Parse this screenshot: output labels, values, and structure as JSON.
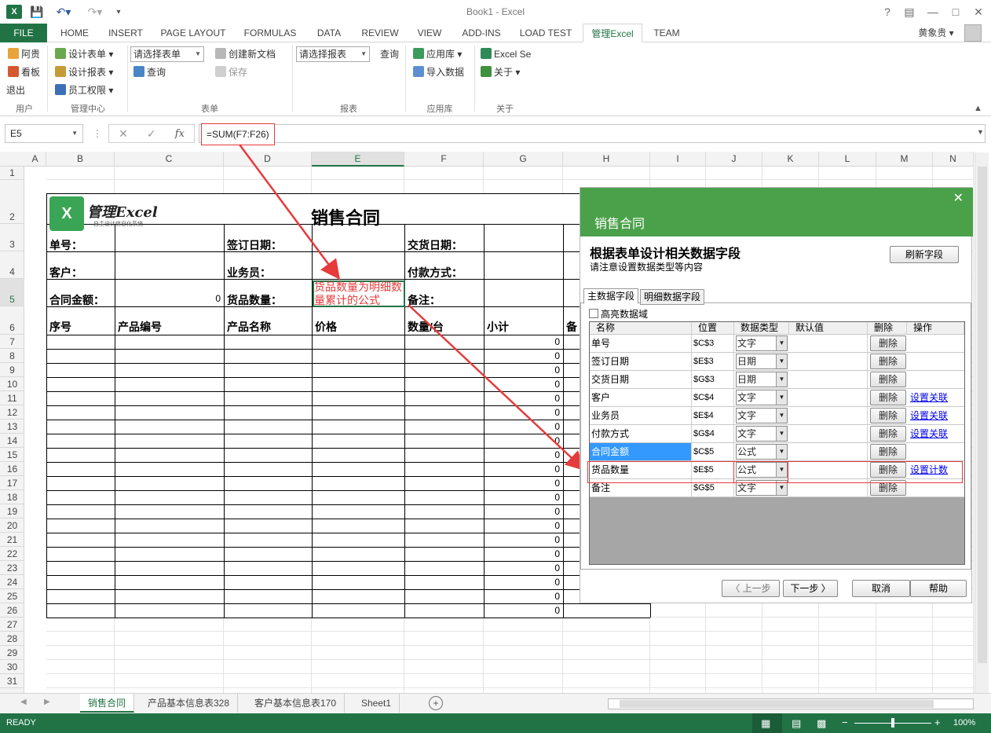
{
  "window": {
    "title": "Book1 - Excel",
    "user": "黄象贵"
  },
  "ribbon_tabs": [
    "FILE",
    "HOME",
    "INSERT",
    "PAGE LAYOUT",
    "FORMULAS",
    "DATA",
    "REVIEW",
    "VIEW",
    "ADD-INS",
    "LOAD TEST",
    "管理Excel",
    "TEAM"
  ],
  "ribbon": {
    "user_group": {
      "label": "用户",
      "items": [
        "阿贵",
        "看板",
        "退出"
      ]
    },
    "admin_group": {
      "label": "管理中心",
      "items": [
        "设计表单",
        "设计报表",
        "员工权限"
      ]
    },
    "form_group": {
      "label": "表单",
      "select_form": "请选择表单",
      "query": "查询",
      "new_doc": "创建新文档",
      "save": "保存"
    },
    "report_group": {
      "label": "报表",
      "select_report": "请选择报表",
      "query": "查询"
    },
    "app_group": {
      "label": "应用库",
      "app_lib": "应用库",
      "import": "导入数据"
    },
    "about_group": {
      "label": "关于",
      "excel_se": "Excel Se",
      "about": "关于"
    }
  },
  "formula_bar": {
    "name_box": "E5",
    "formula": "=SUM(F7:F26)"
  },
  "columns": [
    "A",
    "B",
    "C",
    "D",
    "E",
    "F",
    "G",
    "H",
    "I",
    "J",
    "K",
    "L",
    "M",
    "N"
  ],
  "rows": [
    "1",
    "2",
    "3",
    "4",
    "5",
    "6",
    "7",
    "8",
    "9",
    "10",
    "11",
    "12",
    "13",
    "14",
    "15",
    "16",
    "17",
    "18",
    "19",
    "20",
    "21",
    "22",
    "23",
    "24",
    "25",
    "26",
    "27",
    "28",
    "29",
    "30",
    "31"
  ],
  "sheet": {
    "logo_text": "管理Excel",
    "logo_sub": "自主设计信息化系统",
    "title": "销售合同",
    "labels": {
      "order_no": "单号：",
      "sign_date": "签订日期：",
      "delivery_date": "交货日期：",
      "customer": "客户：",
      "salesman": "业务员：",
      "payment": "付款方式：",
      "amount": "合同金额：",
      "qty": "货品数量：",
      "remark": "备注："
    },
    "amount_value": "0",
    "headers": [
      "序号",
      "产品编号",
      "产品名称",
      "价格",
      "数量/台",
      "小计",
      "备"
    ],
    "subtotal_values": [
      "0",
      "0",
      "0",
      "0",
      "0",
      "0",
      "0",
      "0",
      "0",
      "0",
      "0",
      "0",
      "0",
      "0",
      "0",
      "0",
      "0",
      "0",
      "0",
      "0"
    ],
    "annotation": "货品数量为明细数量累计的公式"
  },
  "dialog": {
    "header": "销售合同",
    "heading": "根据表单设计相关数据字段",
    "subheading": "请注意设置数据类型等内容",
    "refresh_button": "刷新字段",
    "tabs": [
      "主数据字段",
      "明细数据字段"
    ],
    "highlight_checkbox": "高亮数据域",
    "columns": [
      "名称",
      "位置",
      "数据类型",
      "默认值",
      "删除",
      "操作"
    ],
    "fields": [
      {
        "name": "单号",
        "pos": "$C$3",
        "type": "文字",
        "action": ""
      },
      {
        "name": "签订日期",
        "pos": "$E$3",
        "type": "日期",
        "action": ""
      },
      {
        "name": "交货日期",
        "pos": "$G$3",
        "type": "日期",
        "action": ""
      },
      {
        "name": "客户",
        "pos": "$C$4",
        "type": "文字",
        "action": "设置关联"
      },
      {
        "name": "业务员",
        "pos": "$E$4",
        "type": "文字",
        "action": "设置关联"
      },
      {
        "name": "付款方式",
        "pos": "$G$4",
        "type": "文字",
        "action": "设置关联"
      },
      {
        "name": "合同金额",
        "pos": "$C$5",
        "type": "公式",
        "action": ""
      },
      {
        "name": "货品数量",
        "pos": "$E$5",
        "type": "公式",
        "action": "设置计数"
      },
      {
        "name": "备注",
        "pos": "$G$5",
        "type": "文字",
        "action": ""
      }
    ],
    "delete_label": "删除",
    "prev_button": "〈 上一步",
    "next_button": "下一步 〉",
    "cancel_button": "取消",
    "help_button": "帮助"
  },
  "sheet_tabs": [
    "销售合同",
    "产品基本信息表328",
    "客户基本信息表170",
    "Sheet1"
  ],
  "status": {
    "ready": "READY",
    "zoom": "100%"
  },
  "colors": {
    "excel_green": "#217346",
    "dialog_green": "#4aa14a",
    "annotation_red": "#e63b3b"
  }
}
